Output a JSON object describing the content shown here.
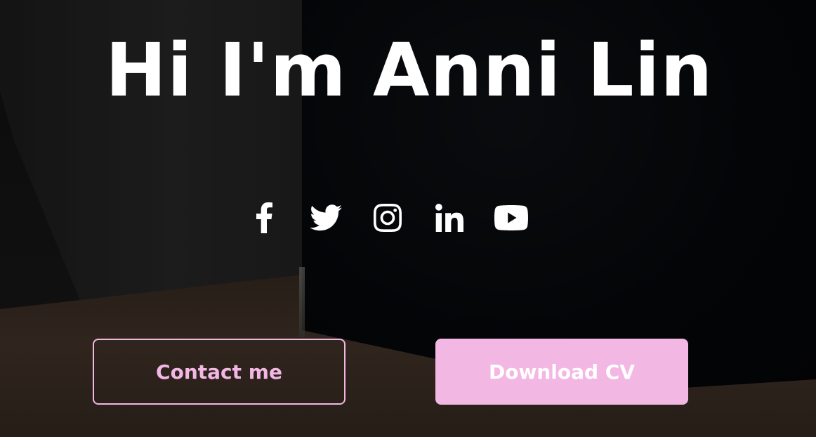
{
  "hero": {
    "title": "Hi I'm Anni Lin"
  },
  "socials": [
    {
      "name": "facebook",
      "icon": "facebook-icon"
    },
    {
      "name": "twitter",
      "icon": "twitter-icon"
    },
    {
      "name": "instagram",
      "icon": "instagram-icon"
    },
    {
      "name": "linkedin",
      "icon": "linkedin-icon"
    },
    {
      "name": "youtube",
      "icon": "youtube-icon"
    }
  ],
  "buttons": {
    "contact_label": "Contact me",
    "download_label": "Download CV"
  },
  "colors": {
    "accent": "#f3b7e4",
    "title": "#ffffff",
    "outline_text": "#f3b7e4",
    "solid_text": "#ffffff"
  }
}
